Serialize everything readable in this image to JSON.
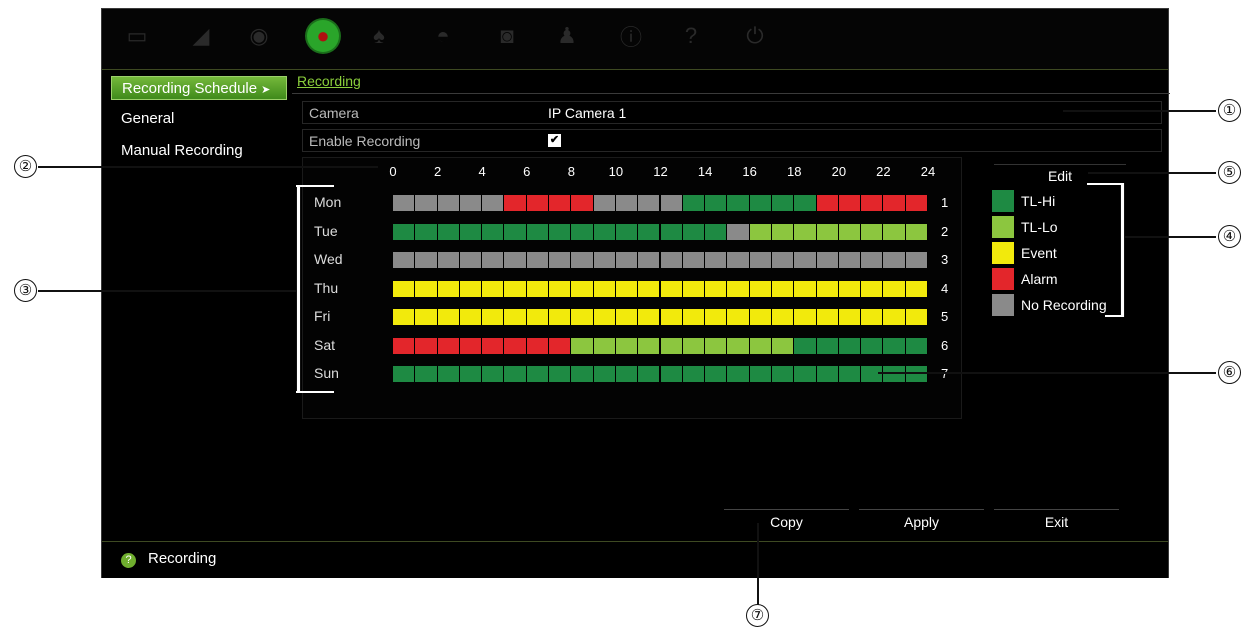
{
  "menu": {
    "active_icon": "recording-icon"
  },
  "sidebar": {
    "items": [
      {
        "label": "Recording Schedule"
      },
      {
        "label": "General"
      },
      {
        "label": "Manual Recording"
      }
    ]
  },
  "tab": {
    "label": "Recording"
  },
  "form": {
    "camera_label": "Camera",
    "camera_value": "IP Camera 1",
    "enable_label": "Enable Recording",
    "enable_checked": true
  },
  "schedule": {
    "hours": [
      "0",
      "2",
      "4",
      "6",
      "8",
      "10",
      "12",
      "14",
      "16",
      "18",
      "20",
      "22",
      "24"
    ],
    "modes": {
      "H": "#1e8a43",
      "L": "#8cc63f",
      "E": "#f2ea0c",
      "A": "#e3262b",
      "N": "#8a8a8a"
    },
    "days": [
      {
        "name": "Mon",
        "num": "1",
        "pattern": "NNNNNAAAANNNNHHHHHHAAAAA"
      },
      {
        "name": "Tue",
        "num": "2",
        "pattern": "HHHHHHHHHHHHHHHNLLLLLLLL"
      },
      {
        "name": "Wed",
        "num": "3",
        "pattern": "NNNNNNNNNNNNNNNNNNNNNNNN"
      },
      {
        "name": "Thu",
        "num": "4",
        "pattern": "EEEEEEEEEEEEEEEEEEEEEEEE"
      },
      {
        "name": "Fri",
        "num": "5",
        "pattern": "EEEEEEEEEEEEEEEEEEEEEEEE"
      },
      {
        "name": "Sat",
        "num": "6",
        "pattern": "AAAAAAAALLLLLLLLLLHHHHHH"
      },
      {
        "name": "Sun",
        "num": "7",
        "pattern": "HHHHHHHHHHHHHHHHHHHHHHHH"
      }
    ]
  },
  "edit_label": "Edit",
  "legend": [
    {
      "label": "TL-Hi",
      "color": "#1e8a43"
    },
    {
      "label": "TL-Lo",
      "color": "#8cc63f"
    },
    {
      "label": "Event",
      "color": "#f2ea0c"
    },
    {
      "label": "Alarm",
      "color": "#e3262b"
    },
    {
      "label": "No Recording",
      "color": "#8a8a8a"
    }
  ],
  "buttons": {
    "copy": "Copy",
    "apply": "Apply",
    "exit": "Exit"
  },
  "status": {
    "text": "Recording"
  },
  "callouts": [
    "①",
    "②",
    "③",
    "④",
    "⑤",
    "⑥",
    "⑦"
  ]
}
